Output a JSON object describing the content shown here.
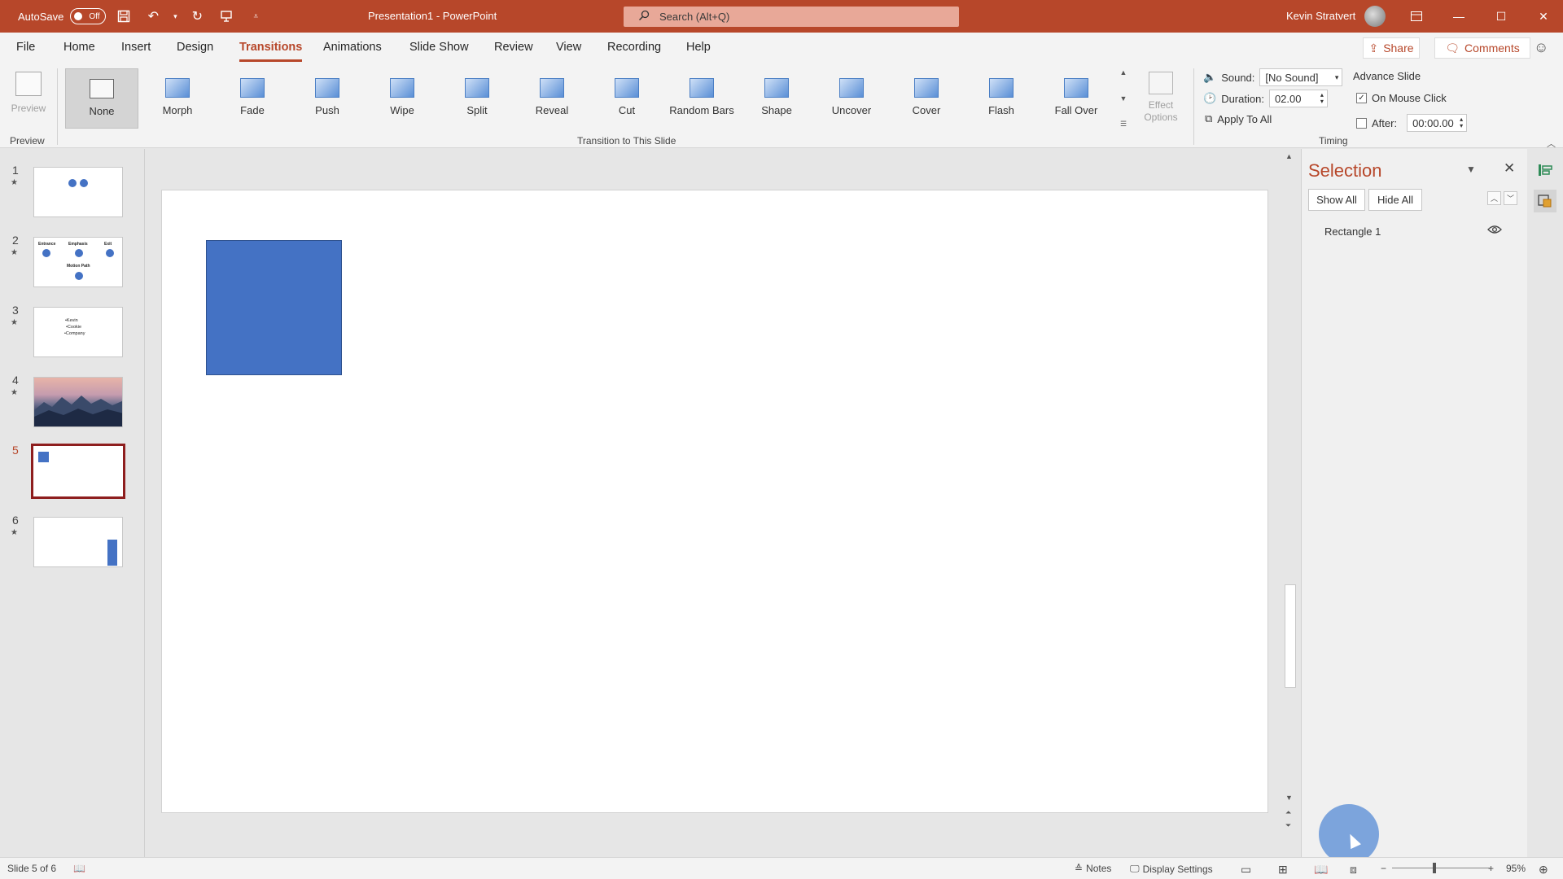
{
  "titlebar": {
    "autosave_label": "AutoSave",
    "autosave_state": "Off",
    "doc_title": "Presentation1  -  PowerPoint",
    "search_placeholder": "Search (Alt+Q)",
    "user_name": "Kevin Stratvert"
  },
  "menu": {
    "tabs": [
      "File",
      "Home",
      "Insert",
      "Design",
      "Transitions",
      "Animations",
      "Slide Show",
      "Review",
      "View",
      "Recording",
      "Help"
    ],
    "active_tab": "Transitions",
    "share_label": "Share",
    "comments_label": "Comments"
  },
  "ribbon": {
    "preview_label": "Preview",
    "preview_group_label": "Preview",
    "transitions": [
      "None",
      "Morph",
      "Fade",
      "Push",
      "Wipe",
      "Split",
      "Reveal",
      "Cut",
      "Random Bars",
      "Shape",
      "Uncover",
      "Cover",
      "Flash",
      "Fall Over"
    ],
    "selected_transition": "None",
    "effect_options_line1": "Effect",
    "effect_options_line2": "Options",
    "transition_group_label": "Transition to This Slide",
    "sound_label": "Sound:",
    "sound_value": "[No Sound]",
    "duration_label": "Duration:",
    "duration_value": "02.00",
    "apply_all_label": "Apply To All",
    "advance_slide_label": "Advance Slide",
    "on_mouse_click_label": "On Mouse Click",
    "on_mouse_click_checked": true,
    "after_label": "After:",
    "after_value": "00:00.00",
    "after_checked": false,
    "timing_group_label": "Timing"
  },
  "thumbnails": {
    "slides": [
      {
        "number": "1",
        "has_star": true
      },
      {
        "number": "2",
        "has_star": true,
        "labels": [
          "Entrance",
          "Emphasis",
          "Exit",
          "Motion Path"
        ]
      },
      {
        "number": "3",
        "has_star": true,
        "lines": [
          "•Kevin",
          "•Cookie",
          "•Company"
        ]
      },
      {
        "number": "4",
        "has_star": true
      },
      {
        "number": "5",
        "has_star": false,
        "active": true
      },
      {
        "number": "6",
        "has_star": true
      }
    ]
  },
  "selection_pane": {
    "title": "Selection",
    "show_all": "Show All",
    "hide_all": "Hide All",
    "items": [
      "Rectangle 1"
    ]
  },
  "status": {
    "slide_info": "Slide 5 of 6",
    "notes_label": "Notes",
    "display_settings_label": "Display Settings",
    "zoom_value": "95%"
  },
  "colors": {
    "accent": "#b7472a",
    "shape_fill": "#4472c4",
    "active_thumb_border": "#8e1e1e"
  }
}
